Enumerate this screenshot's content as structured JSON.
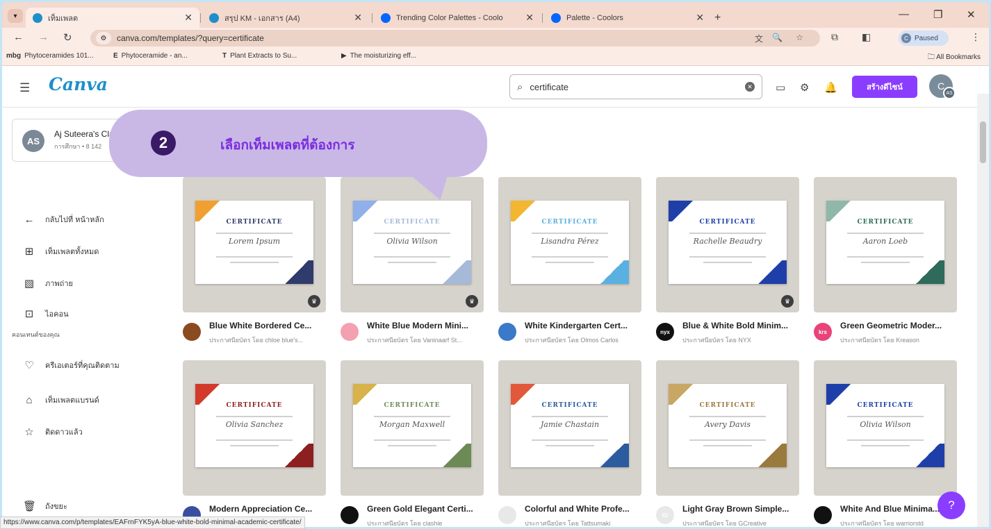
{
  "browser": {
    "tabs": [
      {
        "title": "เท็มเพลต",
        "active": true,
        "color": "#1e8fc9"
      },
      {
        "title": "สรุป KM - เอกสาร (A4)",
        "active": false,
        "color": "#1e8fc9"
      },
      {
        "title": "Trending Color Palettes - Coolo",
        "active": false,
        "color": "#0066ff"
      },
      {
        "title": "Palette - Coolors",
        "active": false,
        "color": "#0066ff"
      }
    ],
    "url": "canva.com/templates/?query=certificate",
    "profile_label": "Paused",
    "profile_initial": "C",
    "bookmarks": [
      {
        "icon": "mbg",
        "label": "Phytoceramides 101..."
      },
      {
        "icon": "E",
        "label": "Phytoceramide - an..."
      },
      {
        "icon": "T",
        "label": "Plant Extracts to Su..."
      },
      {
        "icon": "▶",
        "label": "The moisturizing eff..."
      }
    ],
    "all_bookmarks": "All Bookmarks",
    "status_url": "https://www.canva.com/p/templates/EAFrnFYK5yA-blue-white-bold-minimal-academic-certificate/"
  },
  "header": {
    "logo": "Canva",
    "search_value": "certificate",
    "create_label": "สร้างดีไซน์",
    "avatar_initial": "C",
    "avatar_badge": "AS"
  },
  "sidebar": {
    "team_name": "Aj Suteera's Cla",
    "team_sub": "การศึกษา • 8 142",
    "team_initials": "AS",
    "nav": [
      {
        "icon": "←",
        "label": "กลับไปที่ หน้าหลัก"
      },
      {
        "icon": "⊞",
        "label": "เท็มเพลตทั้งหมด"
      },
      {
        "icon": "▧",
        "label": "ภาพถ่าย"
      },
      {
        "icon": "⊡",
        "label": "ไอคอน"
      }
    ],
    "section_title": "คอนเทนต์ของคุณ",
    "nav2": [
      {
        "icon": "♡",
        "label": "ครีเอเตอร์ที่คุณติดตาม"
      },
      {
        "icon": "⌂",
        "label": "เท็มเพลตแบรนด์"
      },
      {
        "icon": "☆",
        "label": "ติดดาวแล้ว"
      }
    ],
    "trash_icon": "🗑",
    "trash_label": "ถังขยะ"
  },
  "callout": {
    "number": "2",
    "text": "เลือกเท็มเพลตที่ต้องการ"
  },
  "templates": [
    {
      "title": "Blue White Bordered Ce...",
      "by": "ประกาศนียบัตร โดย chloe blue's...",
      "cert": "CERTIFICATE",
      "name": "Lorem Ipsum",
      "accent": "#f0a030",
      "accent2": "#2f3b6b",
      "avatar_color": "#8a4b20",
      "avatar_text": "",
      "pro": true
    },
    {
      "title": "White Blue Modern Mini...",
      "by": "ประกาศนียบัตร โดย Vaninaarf St...",
      "cert": "CERTIFICATE",
      "name": "Olivia Wilson",
      "accent": "#8fb0e8",
      "accent2": "#a7b9d8",
      "avatar_color": "#f3a0b0",
      "avatar_text": "",
      "pro": true
    },
    {
      "title": "White Kindergarten Cert...",
      "by": "ประกาศนียบัตร โดย Olmos Carlos",
      "cert": "CERTIFICATE",
      "name": "Lisandra Pérez",
      "accent": "#f2b630",
      "accent2": "#5ab0e0",
      "avatar_color": "#3a7ac8",
      "avatar_text": "",
      "pro": false
    },
    {
      "title": "Blue & White Bold Minim...",
      "by": "ประกาศนียบัตร โดย NYX",
      "cert": "CERTIFICATE",
      "name": "Rachelle Beaudry",
      "accent": "#1f3fa8",
      "accent2": "#1f3fa8",
      "avatar_color": "#111111",
      "avatar_text": "nyx",
      "pro": true
    },
    {
      "title": "Green Geometric Moder...",
      "by": "ประกาศนียบัตร โดย Kreason",
      "cert": "CERTIFICATE",
      "name": "Aaron Loeb",
      "accent": "#8fb8a8",
      "accent2": "#2e6b5a",
      "avatar_color": "#e8447a",
      "avatar_text": "krs",
      "pro": false
    },
    {
      "title": "Modern Appreciation Ce...",
      "by": "ประกาศนียบัตร",
      "cert": "CERTIFICATE",
      "name": "Olivia Sanchez",
      "accent": "#d33a2c",
      "accent2": "#8c1f1f",
      "avatar_color": "#3a4ea0",
      "avatar_text": "",
      "pro": false
    },
    {
      "title": "Green Gold Elegant Certi...",
      "by": "ประกาศนียบัตร โดย clashie",
      "cert": "CERTIFICATE",
      "name": "Morgan Maxwell",
      "accent": "#d8b24a",
      "accent2": "#6c8a56",
      "avatar_color": "#111111",
      "avatar_text": "",
      "pro": false
    },
    {
      "title": "Colorful and White Profe...",
      "by": "ประกาศนียบัตร โดย Tattsumaki",
      "cert": "CERTIFICATE",
      "name": "Jamie Chastain",
      "accent": "#e2583a",
      "accent2": "#2c5b9e",
      "avatar_color": "#e8e8e8",
      "avatar_text": "",
      "pro": false
    },
    {
      "title": "Light Gray Brown Simple...",
      "by": "ประกาศนียบัตร โดย GCreative",
      "cert": "CERTIFICATE",
      "name": "Avery Davis",
      "accent": "#c8a664",
      "accent2": "#9b7a3d",
      "avatar_color": "#e8e8e8",
      "avatar_text": "Gi",
      "pro": false
    },
    {
      "title": "White And Blue Minima...",
      "by": "ประกาศนียบัตร โดย warriorstd",
      "cert": "CERTIFICATE",
      "name": "Olivia Wilson",
      "accent": "#1f3fa8",
      "accent2": "#1f3fa8",
      "avatar_color": "#111111",
      "avatar_text": "",
      "pro": false
    }
  ],
  "help_label": "?"
}
